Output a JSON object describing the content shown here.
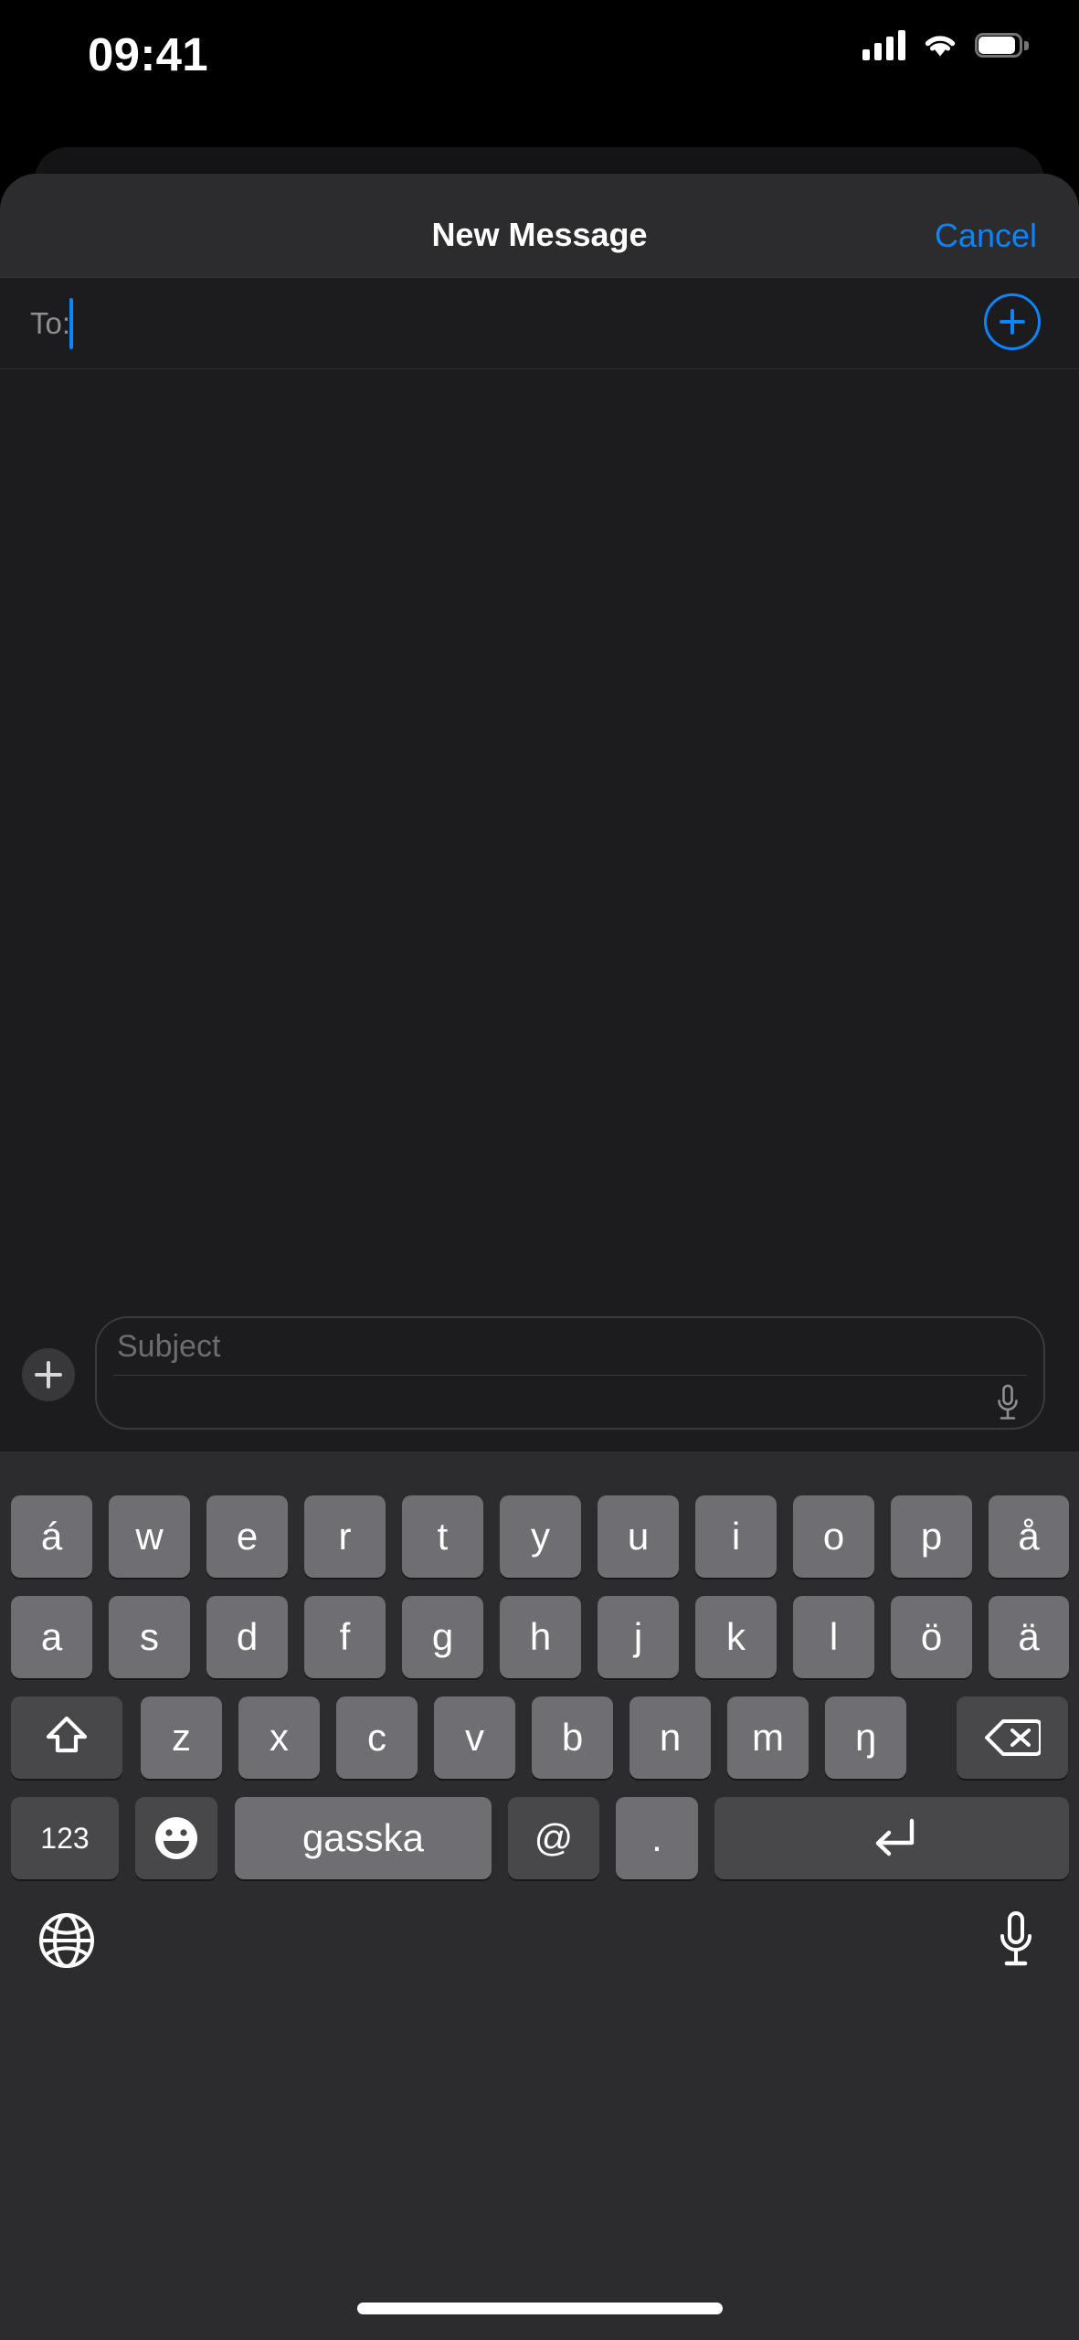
{
  "status_bar": {
    "time": "09:41",
    "signal_icon": "cellular-signal-icon",
    "wifi_icon": "wifi-icon",
    "battery_icon": "battery-icon"
  },
  "navbar": {
    "title": "New Message",
    "cancel_label": "Cancel",
    "accent_color": "#0a84ff"
  },
  "recipients": {
    "to_label": "To:",
    "value": "",
    "add_contact_icon": "add-contact-plus-icon"
  },
  "compose": {
    "attach_icon": "plus-icon",
    "subject_placeholder": "Subject",
    "subject_value": "",
    "body_value": "",
    "dictate_icon": "microphone-icon"
  },
  "keyboard": {
    "language": "Northern Sami",
    "rows": [
      {
        "name": "row-1",
        "keys": [
          {
            "label": "á",
            "type": "letter"
          },
          {
            "label": "w",
            "type": "letter"
          },
          {
            "label": "e",
            "type": "letter"
          },
          {
            "label": "r",
            "type": "letter"
          },
          {
            "label": "t",
            "type": "letter"
          },
          {
            "label": "y",
            "type": "letter"
          },
          {
            "label": "u",
            "type": "letter"
          },
          {
            "label": "i",
            "type": "letter"
          },
          {
            "label": "o",
            "type": "letter"
          },
          {
            "label": "p",
            "type": "letter"
          },
          {
            "label": "å",
            "type": "letter"
          }
        ]
      },
      {
        "name": "row-2",
        "keys": [
          {
            "label": "a",
            "type": "letter"
          },
          {
            "label": "s",
            "type": "letter"
          },
          {
            "label": "d",
            "type": "letter"
          },
          {
            "label": "f",
            "type": "letter"
          },
          {
            "label": "g",
            "type": "letter"
          },
          {
            "label": "h",
            "type": "letter"
          },
          {
            "label": "j",
            "type": "letter"
          },
          {
            "label": "k",
            "type": "letter"
          },
          {
            "label": "l",
            "type": "letter"
          },
          {
            "label": "ö",
            "type": "letter"
          },
          {
            "label": "ä",
            "type": "letter"
          }
        ]
      },
      {
        "name": "row-3",
        "keys": [
          {
            "label": "",
            "type": "shift",
            "icon": "shift-arrow-icon"
          },
          {
            "label": "z",
            "type": "letter"
          },
          {
            "label": "x",
            "type": "letter"
          },
          {
            "label": "c",
            "type": "letter"
          },
          {
            "label": "v",
            "type": "letter"
          },
          {
            "label": "b",
            "type": "letter"
          },
          {
            "label": "n",
            "type": "letter"
          },
          {
            "label": "m",
            "type": "letter"
          },
          {
            "label": "ŋ",
            "type": "letter"
          },
          {
            "label": "",
            "type": "backspace",
            "icon": "backspace-delete-icon"
          }
        ]
      },
      {
        "name": "row-4",
        "keys": [
          {
            "label": "123",
            "type": "numeric"
          },
          {
            "label": "",
            "type": "emoji",
            "icon": "emoji-smiley-icon"
          },
          {
            "label": "gasska",
            "type": "space"
          },
          {
            "label": "@",
            "type": "at"
          },
          {
            "label": ".",
            "type": "period"
          },
          {
            "label": "",
            "type": "return",
            "icon": "return-arrow-icon"
          }
        ]
      }
    ],
    "bottom_bar": {
      "globe_icon": "globe-language-icon",
      "mic_icon": "microphone-dictation-icon"
    }
  },
  "home_indicator": "home-indicator-bar"
}
